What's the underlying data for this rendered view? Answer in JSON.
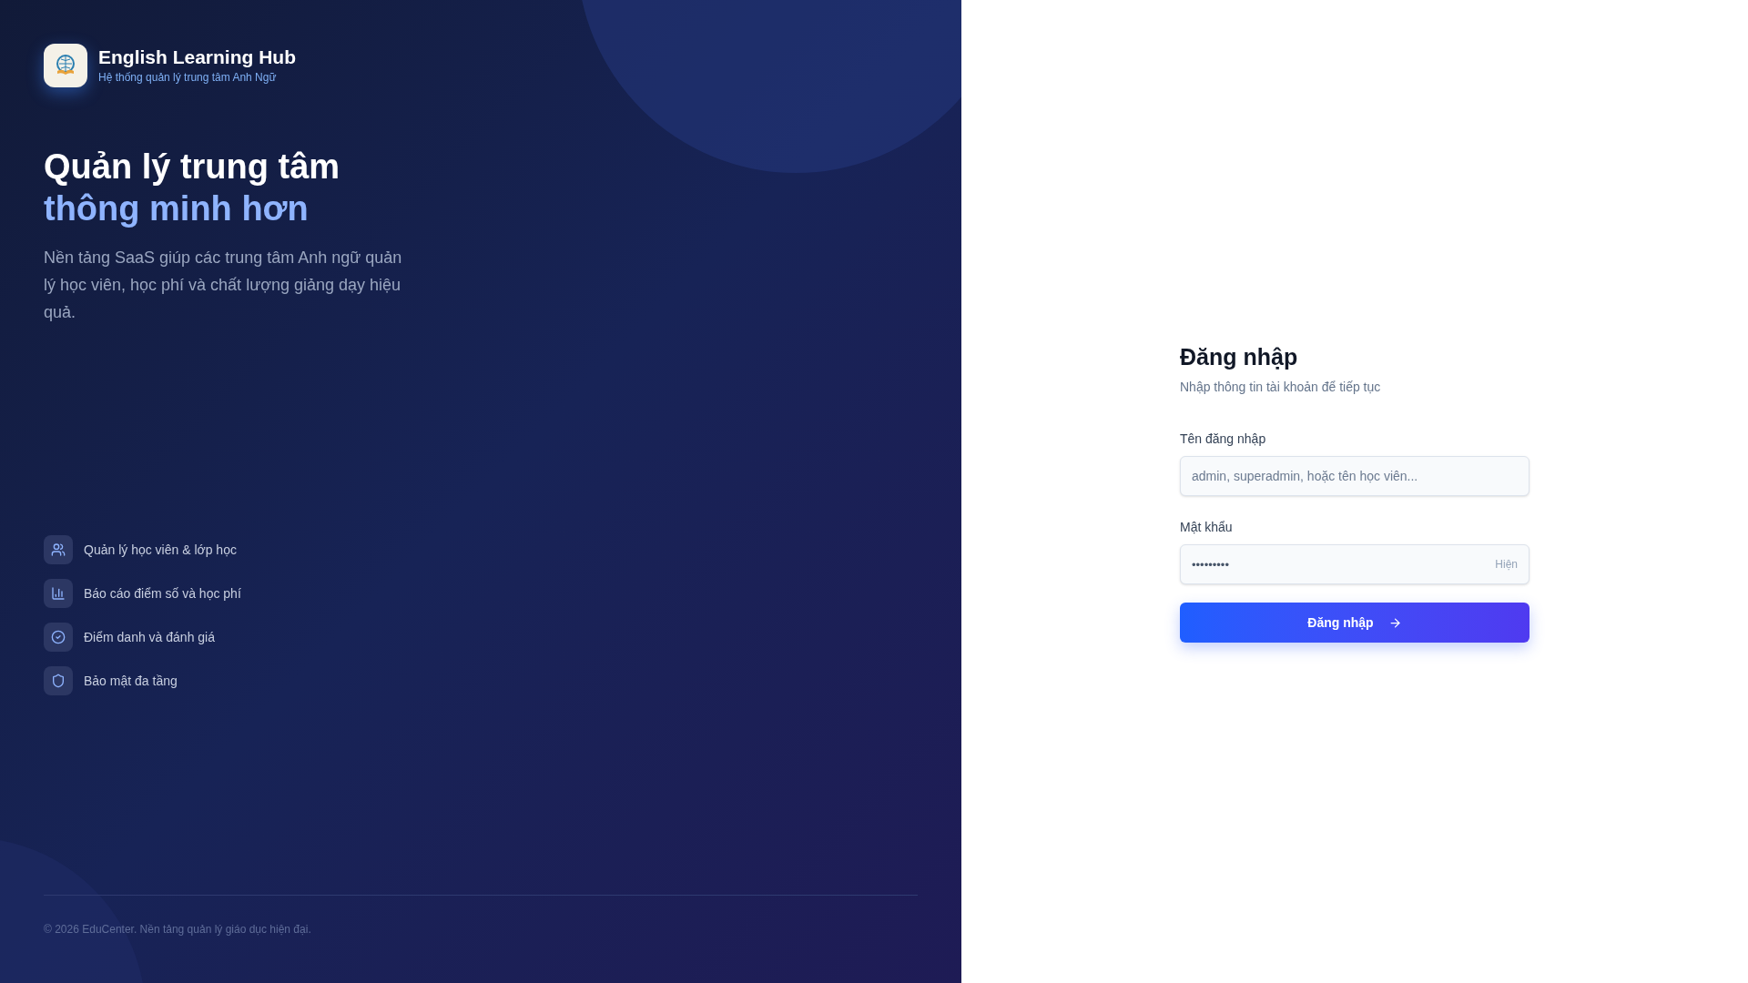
{
  "brand": {
    "name": "English Learning Hub",
    "tagline": "Hệ thống quản lý trung tâm Anh Ngữ"
  },
  "hero": {
    "title": "Quản lý trung tâm",
    "highlight": "thông minh hơn",
    "description": "Nền tảng SaaS giúp các trung tâm Anh ngữ quản lý học viên, học phí và chất lượng giảng dạy hiệu quả."
  },
  "features": [
    {
      "kind": "users",
      "label": "Quản lý học viên & lớp học"
    },
    {
      "kind": "chart",
      "label": "Báo cáo điểm số và học phí"
    },
    {
      "kind": "check",
      "label": "Điểm danh và đánh giá"
    },
    {
      "kind": "shield",
      "label": "Bảo mật đa tầng"
    }
  ],
  "footer": "© 2026 EduCenter. Nền tảng quản lý giáo dục hiện đại.",
  "login": {
    "title": "Đăng nhập",
    "subtitle": "Nhập thông tin tài khoản để tiếp tục",
    "username": {
      "label": "Tên đăng nhập",
      "placeholder": "admin, superadmin, hoặc tên học viên..."
    },
    "password": {
      "label": "Mật khẩu",
      "value": "•••••••••",
      "toggle": "Hiện"
    },
    "submit": "Đăng nhập"
  }
}
